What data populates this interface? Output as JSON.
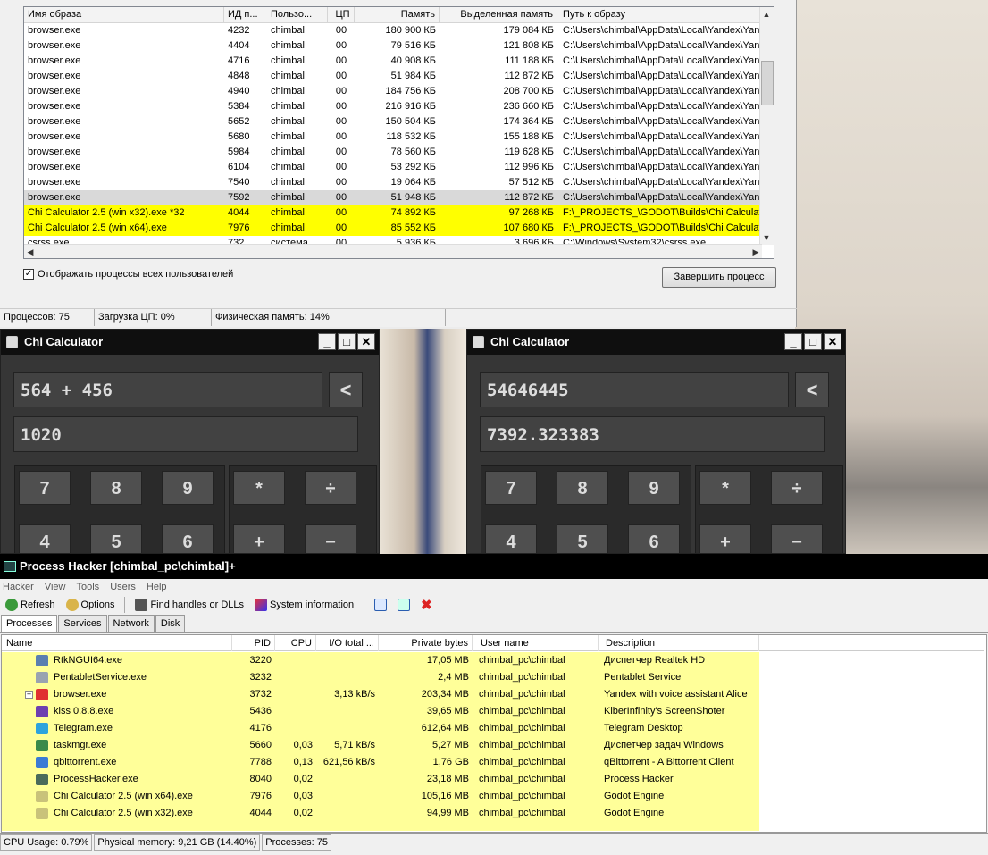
{
  "task_manager": {
    "columns": [
      "Имя образа",
      "ИД п...",
      "Пользо...",
      "ЦП",
      "Память",
      "Выделенная память",
      "Путь к образу"
    ],
    "rows": [
      [
        "browser.exe",
        "4232",
        "chimbal",
        "00",
        "180 900 КБ",
        "179 084 КБ",
        "C:\\Users\\chimbal\\AppData\\Local\\Yandex\\Yand"
      ],
      [
        "browser.exe",
        "4404",
        "chimbal",
        "00",
        "79 516 КБ",
        "121 808 КБ",
        "C:\\Users\\chimbal\\AppData\\Local\\Yandex\\Yand"
      ],
      [
        "browser.exe",
        "4716",
        "chimbal",
        "00",
        "40 908 КБ",
        "111 188 КБ",
        "C:\\Users\\chimbal\\AppData\\Local\\Yandex\\Yand"
      ],
      [
        "browser.exe",
        "4848",
        "chimbal",
        "00",
        "51 984 КБ",
        "112 872 КБ",
        "C:\\Users\\chimbal\\AppData\\Local\\Yandex\\Yand"
      ],
      [
        "browser.exe",
        "4940",
        "chimbal",
        "00",
        "184 756 КБ",
        "208 700 КБ",
        "C:\\Users\\chimbal\\AppData\\Local\\Yandex\\Yand"
      ],
      [
        "browser.exe",
        "5384",
        "chimbal",
        "00",
        "216 916 КБ",
        "236 660 КБ",
        "C:\\Users\\chimbal\\AppData\\Local\\Yandex\\Yand"
      ],
      [
        "browser.exe",
        "5652",
        "chimbal",
        "00",
        "150 504 КБ",
        "174 364 КБ",
        "C:\\Users\\chimbal\\AppData\\Local\\Yandex\\Yand"
      ],
      [
        "browser.exe",
        "5680",
        "chimbal",
        "00",
        "118 532 КБ",
        "155 188 КБ",
        "C:\\Users\\chimbal\\AppData\\Local\\Yandex\\Yand"
      ],
      [
        "browser.exe",
        "5984",
        "chimbal",
        "00",
        "78 560 КБ",
        "119 628 КБ",
        "C:\\Users\\chimbal\\AppData\\Local\\Yandex\\Yand"
      ],
      [
        "browser.exe",
        "6104",
        "chimbal",
        "00",
        "53 292 КБ",
        "112 996 КБ",
        "C:\\Users\\chimbal\\AppData\\Local\\Yandex\\Yand"
      ],
      [
        "browser.exe",
        "7540",
        "chimbal",
        "00",
        "19 064 КБ",
        "57 512 КБ",
        "C:\\Users\\chimbal\\AppData\\Local\\Yandex\\Yand"
      ],
      [
        "browser.exe",
        "7592",
        "chimbal",
        "00",
        "51 948 КБ",
        "112 872 КБ",
        "C:\\Users\\chimbal\\AppData\\Local\\Yandex\\Yand"
      ],
      [
        "Chi Calculator 2.5 (win x32).exe *32",
        "4044",
        "chimbal",
        "00",
        "74 892 КБ",
        "97 268 КБ",
        "F:\\_PROJECTS_\\GODOT\\Builds\\Chi Calculator"
      ],
      [
        "Chi Calculator 2.5 (win x64).exe",
        "7976",
        "chimbal",
        "00",
        "85 552 КБ",
        "107 680 КБ",
        "F:\\_PROJECTS_\\GODOT\\Builds\\Chi Calculator"
      ],
      [
        "csrss.exe",
        "732",
        "система",
        "00",
        "5 936 КБ",
        "3 696 КБ",
        "C:\\Windows\\System32\\csrss.exe"
      ]
    ],
    "show_all_users_label": "Отображать процессы всех пользователей",
    "end_process_label": "Завершить процесс",
    "status": [
      "Процессов: 75",
      "Загрузка ЦП: 0%",
      "Физическая память: 14%"
    ]
  },
  "calc_left": {
    "title": "Chi Calculator",
    "input": "564 + 456",
    "output": "1020",
    "back": "<",
    "keys": [
      "7",
      "8",
      "9",
      "*",
      "÷",
      "4",
      "5",
      "6",
      "+",
      "−"
    ]
  },
  "calc_right": {
    "title": "Chi Calculator",
    "input": "54646445",
    "output": "7392.323383",
    "back": "<",
    "keys": [
      "7",
      "8",
      "9",
      "*",
      "÷",
      "4",
      "5",
      "6",
      "+",
      "−"
    ]
  },
  "process_hacker": {
    "title": "Process Hacker [chimbal_pc\\chimbal]+",
    "menu": [
      "Hacker",
      "View",
      "Tools",
      "Users",
      "Help"
    ],
    "toolbar": {
      "refresh": "Refresh",
      "options": "Options",
      "find": "Find handles or DLLs",
      "sysinfo": "System information"
    },
    "tabs": [
      "Processes",
      "Services",
      "Network",
      "Disk"
    ],
    "columns": [
      "Name",
      "PID",
      "CPU",
      "I/O total ...",
      "Private bytes",
      "User name",
      "Description"
    ],
    "rows": [
      {
        "name": "RtkNGUI64.exe",
        "pid": "3220",
        "cpu": "",
        "io": "",
        "private": "17,05 MB",
        "user": "chimbal_pc\\chimbal",
        "desc": "Диспетчер Realtek HD",
        "icon": "#5a7fb0"
      },
      {
        "name": "PentabletService.exe",
        "pid": "3232",
        "cpu": "",
        "io": "",
        "private": "2,4 MB",
        "user": "chimbal_pc\\chimbal",
        "desc": "Pentablet Service",
        "icon": "#9aa3b0"
      },
      {
        "name": "browser.exe",
        "pid": "3732",
        "cpu": "",
        "io": "3,13 kB/s",
        "private": "203,34 MB",
        "user": "chimbal_pc\\chimbal",
        "desc": "Yandex with voice assistant Alice",
        "icon": "#e03030"
      },
      {
        "name": "kiss 0.8.8.exe",
        "pid": "5436",
        "cpu": "",
        "io": "",
        "private": "39,65 MB",
        "user": "chimbal_pc\\chimbal",
        "desc": "KiberInfinity's ScreenShoter",
        "icon": "#6d3fb0"
      },
      {
        "name": "Telegram.exe",
        "pid": "4176",
        "cpu": "",
        "io": "",
        "private": "612,64 MB",
        "user": "chimbal_pc\\chimbal",
        "desc": "Telegram Desktop",
        "icon": "#2ea3dd"
      },
      {
        "name": "taskmgr.exe",
        "pid": "5660",
        "cpu": "0,03",
        "io": "5,71 kB/s",
        "private": "5,27 MB",
        "user": "chimbal_pc\\chimbal",
        "desc": "Диспетчер задач Windows",
        "icon": "#3a8a4a"
      },
      {
        "name": "qbittorrent.exe",
        "pid": "7788",
        "cpu": "0,13",
        "io": "621,56 kB/s",
        "private": "1,76 GB",
        "user": "chimbal_pc\\chimbal",
        "desc": "qBittorrent - A Bittorrent Client",
        "icon": "#3b7bd4"
      },
      {
        "name": "ProcessHacker.exe",
        "pid": "8040",
        "cpu": "0,02",
        "io": "",
        "private": "23,18 MB",
        "user": "chimbal_pc\\chimbal",
        "desc": "Process Hacker",
        "icon": "#4a6b5a"
      },
      {
        "name": "Chi Calculator 2.5 (win x64).exe",
        "pid": "7976",
        "cpu": "0,03",
        "io": "",
        "private": "105,16 MB",
        "user": "chimbal_pc\\chimbal",
        "desc": "Godot Engine",
        "icon": "#c9c27a"
      },
      {
        "name": "Chi Calculator 2.5 (win x32).exe",
        "pid": "4044",
        "cpu": "0,02",
        "io": "",
        "private": "94,99 MB",
        "user": "chimbal_pc\\chimbal",
        "desc": "Godot Engine",
        "icon": "#c9c27a"
      }
    ],
    "status": [
      "CPU Usage: 0.79%",
      "Physical memory: 9,21 GB (14.40%)",
      "Processes: 75"
    ]
  }
}
